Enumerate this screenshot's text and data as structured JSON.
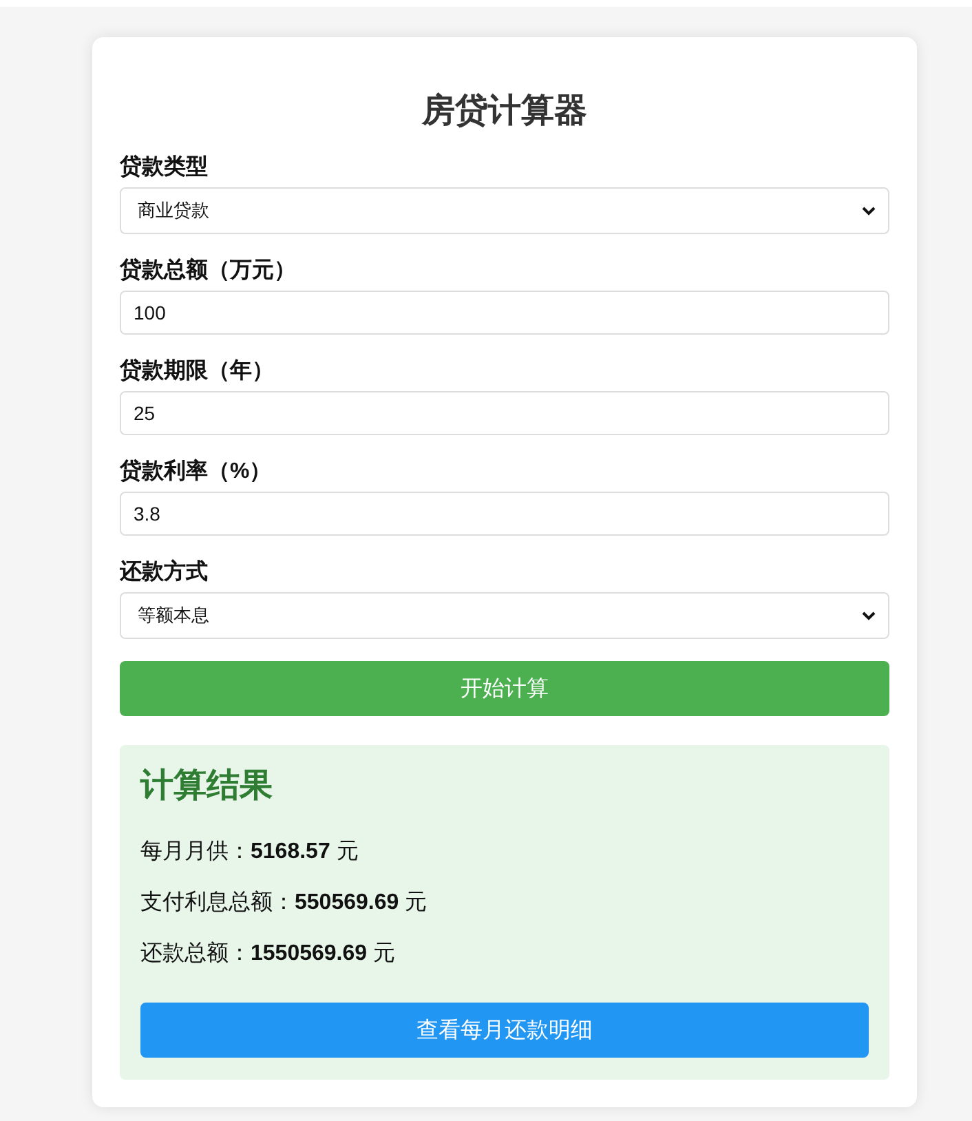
{
  "title": "房贷计算器",
  "fields": [
    {
      "kind": "select",
      "label": "贷款类型",
      "value": "商业贷款"
    },
    {
      "kind": "input",
      "label": "贷款总额（万元）",
      "value": "100"
    },
    {
      "kind": "input",
      "label": "贷款期限（年）",
      "value": "25"
    },
    {
      "kind": "input",
      "label": "贷款利率（%）",
      "value": "3.8"
    },
    {
      "kind": "select",
      "label": "还款方式",
      "value": "等额本息"
    }
  ],
  "calculate_button": "开始计算",
  "result": {
    "title": "计算结果",
    "lines": [
      "每月月供：**5168.57** 元",
      "支付利息总额：**550569.69** 元",
      "还款总额：**1550569.69** 元"
    ],
    "detail_button": "查看每月还款明细"
  }
}
